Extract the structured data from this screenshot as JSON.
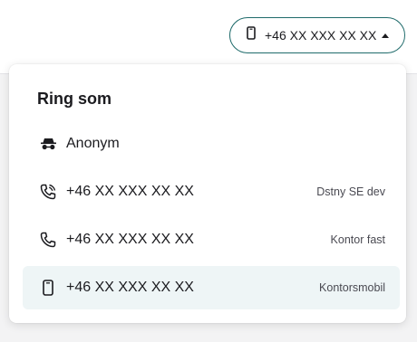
{
  "caller_button": {
    "icon": "mobile-phone-icon",
    "number": "+46 XX XXX XX XX",
    "caret": "caret-up-icon",
    "border_color": "#1f6b6b"
  },
  "menu": {
    "title": "Ring som",
    "options": [
      {
        "icon": "incognito-icon",
        "label": "Anonym",
        "tag": "",
        "selected": false
      },
      {
        "icon": "phone-forward-icon",
        "label": "+46 XX XXX XX XX",
        "tag": "Dstny SE dev",
        "selected": false
      },
      {
        "icon": "phone-icon",
        "label": "+46 XX XXX XX XX",
        "tag": "Kontor fast",
        "selected": false
      },
      {
        "icon": "mobile-phone-icon",
        "label": "+46 XX XXX XX XX",
        "tag": "Kontorsmobil",
        "selected": true
      }
    ],
    "selected_bg": "#eef5f6"
  }
}
